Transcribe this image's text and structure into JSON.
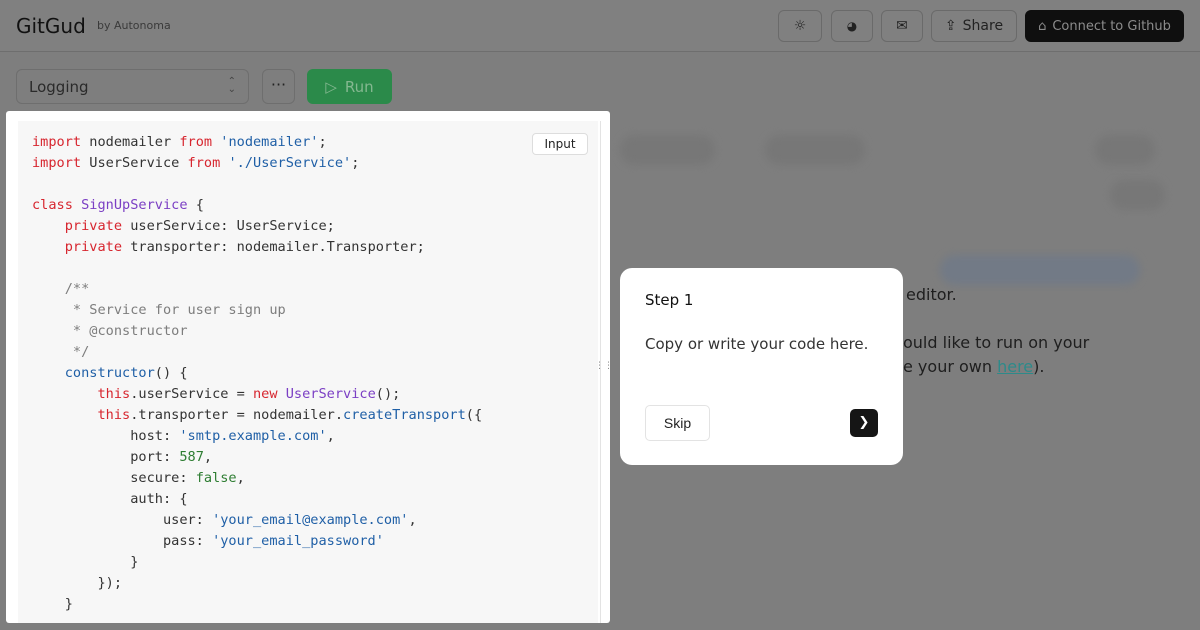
{
  "header": {
    "logo": "GitGud",
    "byline": "by Autonoma",
    "theme_icon": "sun-icon",
    "discord_icon": "discord-icon",
    "mail_icon": "mail-icon",
    "share_label": "Share",
    "github_label": "Connect to Github"
  },
  "toolbar": {
    "example_select": "Logging",
    "more_label": "···",
    "run_label": "Run"
  },
  "editor": {
    "input_label": "Input",
    "lines": [
      [
        [
          "import",
          "kw"
        ],
        [
          " nodemailer ",
          ""
        ],
        [
          "from",
          "kw"
        ],
        [
          " ",
          ""
        ],
        [
          "'nodemailer'",
          "str"
        ],
        [
          ";",
          ""
        ]
      ],
      [
        [
          "import",
          "kw"
        ],
        [
          " UserService ",
          ""
        ],
        [
          "from",
          "kw"
        ],
        [
          " ",
          ""
        ],
        [
          "'./UserService'",
          "str"
        ],
        [
          ";",
          ""
        ]
      ],
      [],
      [
        [
          "class",
          "kw"
        ],
        [
          " ",
          ""
        ],
        [
          "SignUpService",
          "cls"
        ],
        [
          " {",
          ""
        ]
      ],
      [
        [
          "    ",
          ""
        ],
        [
          "private",
          "kw"
        ],
        [
          " userService: UserService;",
          ""
        ]
      ],
      [
        [
          "    ",
          ""
        ],
        [
          "private",
          "kw"
        ],
        [
          " transporter: nodemailer.Transporter;",
          ""
        ]
      ],
      [],
      [
        [
          "    /**",
          "cm"
        ]
      ],
      [
        [
          "     * Service for user sign up",
          "cm"
        ]
      ],
      [
        [
          "     * @constructor",
          "cm"
        ]
      ],
      [
        [
          "     */",
          "cm"
        ]
      ],
      [
        [
          "    ",
          ""
        ],
        [
          "constructor",
          "fn"
        ],
        [
          "() {",
          ""
        ]
      ],
      [
        [
          "        ",
          ""
        ],
        [
          "this",
          "kw"
        ],
        [
          ".userService = ",
          ""
        ],
        [
          "new",
          "kw"
        ],
        [
          " ",
          ""
        ],
        [
          "UserService",
          "cls"
        ],
        [
          "();",
          ""
        ]
      ],
      [
        [
          "        ",
          ""
        ],
        [
          "this",
          "kw"
        ],
        [
          ".transporter = nodemailer.",
          ""
        ],
        [
          "createTransport",
          "fn"
        ],
        [
          "({",
          ""
        ]
      ],
      [
        [
          "            host: ",
          ""
        ],
        [
          "'smtp.example.com'",
          "str"
        ],
        [
          ",",
          ""
        ]
      ],
      [
        [
          "            port: ",
          ""
        ],
        [
          "587",
          "num"
        ],
        [
          ",",
          ""
        ]
      ],
      [
        [
          "            secure: ",
          ""
        ],
        [
          "false",
          "num"
        ],
        [
          ",",
          ""
        ]
      ],
      [
        [
          "            auth: {",
          ""
        ]
      ],
      [
        [
          "                user: ",
          ""
        ],
        [
          "'your_email@example.com'",
          "str"
        ],
        [
          ",",
          ""
        ]
      ],
      [
        [
          "                pass: ",
          ""
        ],
        [
          "'your_email_password'",
          "str"
        ]
      ],
      [
        [
          "            }",
          ""
        ]
      ],
      [
        [
          "        });",
          ""
        ]
      ],
      [
        [
          "    }",
          ""
        ]
      ]
    ]
  },
  "background": {
    "line1": "editor.",
    "line2": "ould like to run on your",
    "line3": "e your own ",
    "link": "here",
    "line3_end": ")."
  },
  "tour": {
    "title": "Step 1",
    "body": "Copy or write your code here.",
    "skip_label": "Skip",
    "next_icon": "chevron-right-icon"
  }
}
